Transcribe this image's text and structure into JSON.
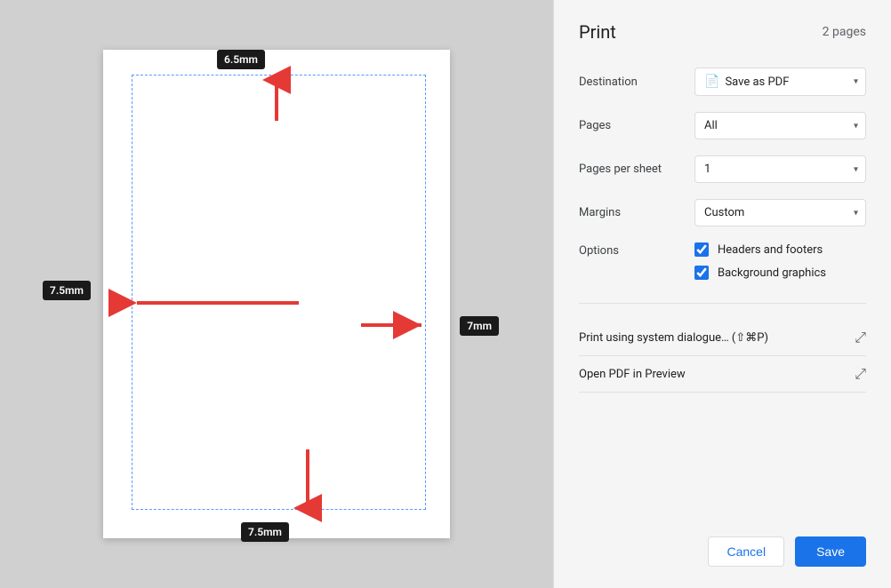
{
  "panel": {
    "title": "Print",
    "page_count": "2 pages",
    "destination_label": "Destination",
    "destination_value": "Save as PDF",
    "pages_label": "Pages",
    "pages_value": "All",
    "pages_per_sheet_label": "Pages per sheet",
    "pages_per_sheet_value": "1",
    "margins_label": "Margins",
    "margins_value": "Custom",
    "options_label": "Options",
    "option1_label": "Headers and footers",
    "option2_label": "Background graphics",
    "link1_label": "Print using system dialogue… (⇧⌘P)",
    "link2_label": "Open PDF in Preview",
    "cancel_label": "Cancel",
    "save_label": "Save"
  },
  "preview": {
    "top_margin": "6.5mm",
    "bottom_margin": "7.5mm",
    "left_margin": "7.5mm",
    "right_margin": "7mm"
  }
}
